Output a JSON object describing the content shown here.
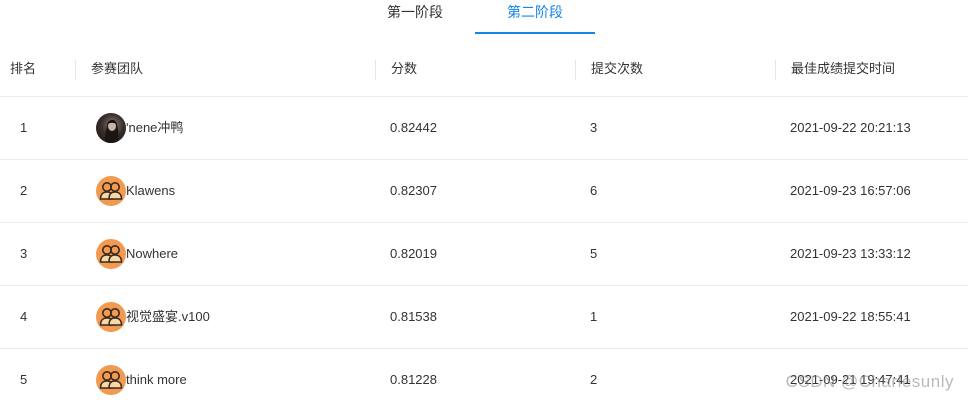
{
  "tabs": [
    {
      "label": "第一阶段",
      "active": false
    },
    {
      "label": "第二阶段",
      "active": true
    }
  ],
  "table": {
    "headers": {
      "rank": "排名",
      "team": "参赛团队",
      "score": "分数",
      "submissions": "提交次数",
      "best_time": "最佳成绩提交时间"
    },
    "rows": [
      {
        "rank": "1",
        "team": "ʹnene冲鸭",
        "avatar": "user-photo-avatar",
        "score": "0.82442",
        "submissions": "3",
        "best_time": "2021-09-22 20:21:13"
      },
      {
        "rank": "2",
        "team": "Klawens",
        "avatar": "team-group-icon",
        "score": "0.82307",
        "submissions": "6",
        "best_time": "2021-09-23 16:57:06"
      },
      {
        "rank": "3",
        "team": "Nowhere",
        "avatar": "team-group-icon",
        "score": "0.82019",
        "submissions": "5",
        "best_time": "2021-09-23 13:33:12"
      },
      {
        "rank": "4",
        "team": "视觉盛宴.v100",
        "avatar": "team-group-icon",
        "score": "0.81538",
        "submissions": "1",
        "best_time": "2021-09-22 18:55:41"
      },
      {
        "rank": "5",
        "team": "think more",
        "avatar": "team-group-icon",
        "score": "0.81228",
        "submissions": "2",
        "best_time": "2021-09-21 19:47:41"
      }
    ]
  },
  "watermark": "CSDN @Charlesunly",
  "colors": {
    "accent": "#1684e6",
    "avatar_orange": "#f29a52"
  }
}
